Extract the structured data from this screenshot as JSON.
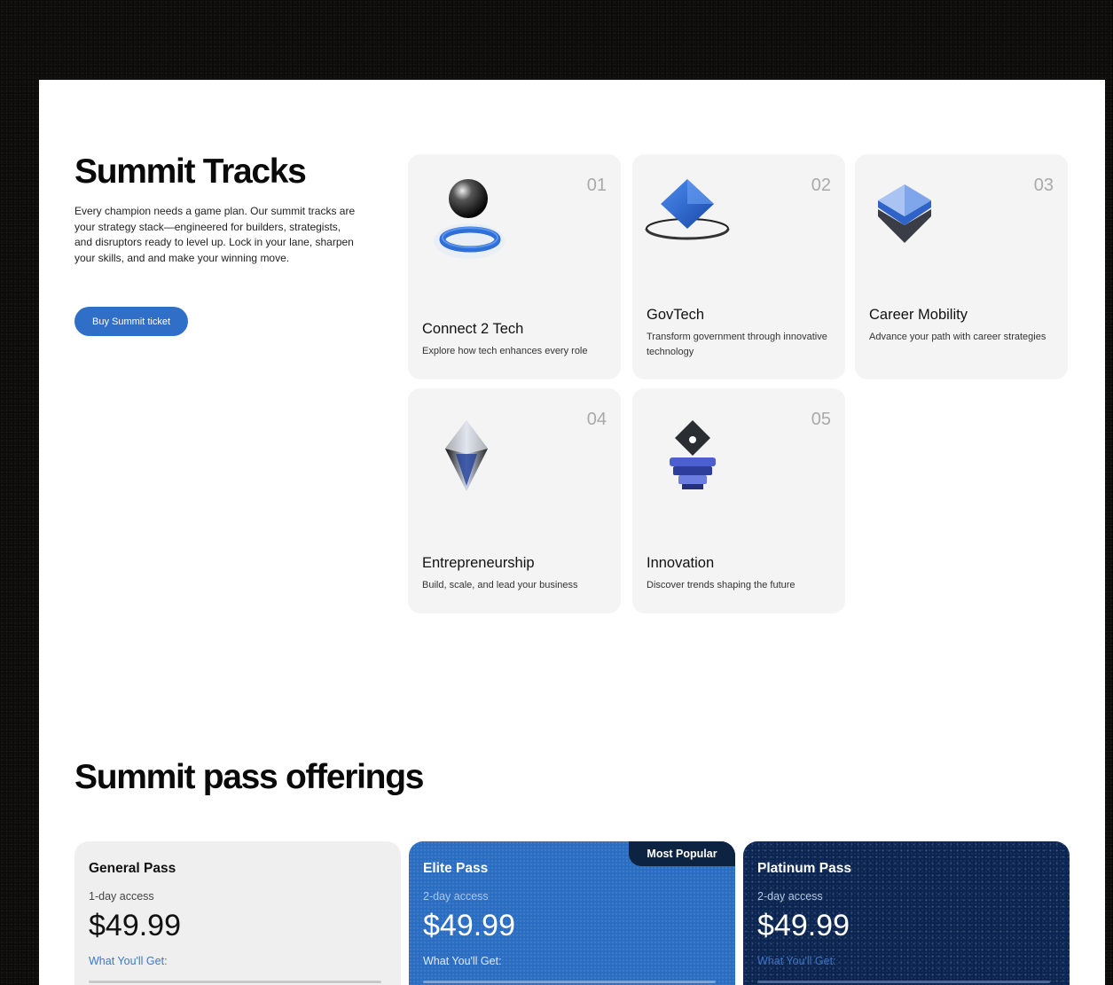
{
  "tracks_section": {
    "title": "Summit Tracks",
    "description": "Every champion needs a game plan. Our summit tracks are your strategy stack—engineered for builders, strategists, and disruptors ready to level up. Lock in your lane, sharpen your skills, and and make your winning move.",
    "cta_label": "Buy Summit ticket",
    "tracks": [
      {
        "number": "01",
        "name": "Connect 2 Tech",
        "description": "Explore how tech enhances every role",
        "icon": "sphere-ring-icon"
      },
      {
        "number": "02",
        "name": "GovTech",
        "description": "Transform government through innovative technology",
        "icon": "diamond-orbit-icon"
      },
      {
        "number": "03",
        "name": "Career Mobility",
        "description": "Advance your path with career strategies",
        "icon": "layers-stack-icon"
      },
      {
        "number": "04",
        "name": "Entrepreneurship",
        "description": "Build, scale, and lead your business",
        "icon": "crystal-gem-icon"
      },
      {
        "number": "05",
        "name": "Innovation",
        "description": "Discover trends shaping the future",
        "icon": "pedestal-diamond-icon"
      }
    ]
  },
  "passes_section": {
    "title": "Summit pass offerings",
    "passes": [
      {
        "name": "General Pass",
        "access": "1-day access",
        "price": "$49.99",
        "includes_label": "What You'll Get:"
      },
      {
        "name": "Elite Pass",
        "access": "2-day access",
        "price": "$49.99",
        "includes_label": "What You'll Get:",
        "badge": "Most Popular"
      },
      {
        "name": "Platinum Pass",
        "access": "2-day access",
        "price": "$49.99",
        "includes_label": "What You'll Get:"
      }
    ]
  },
  "colors": {
    "accent": "#2f6fc8",
    "navy": "#0b2550",
    "card_bg": "#f4f4f4"
  }
}
